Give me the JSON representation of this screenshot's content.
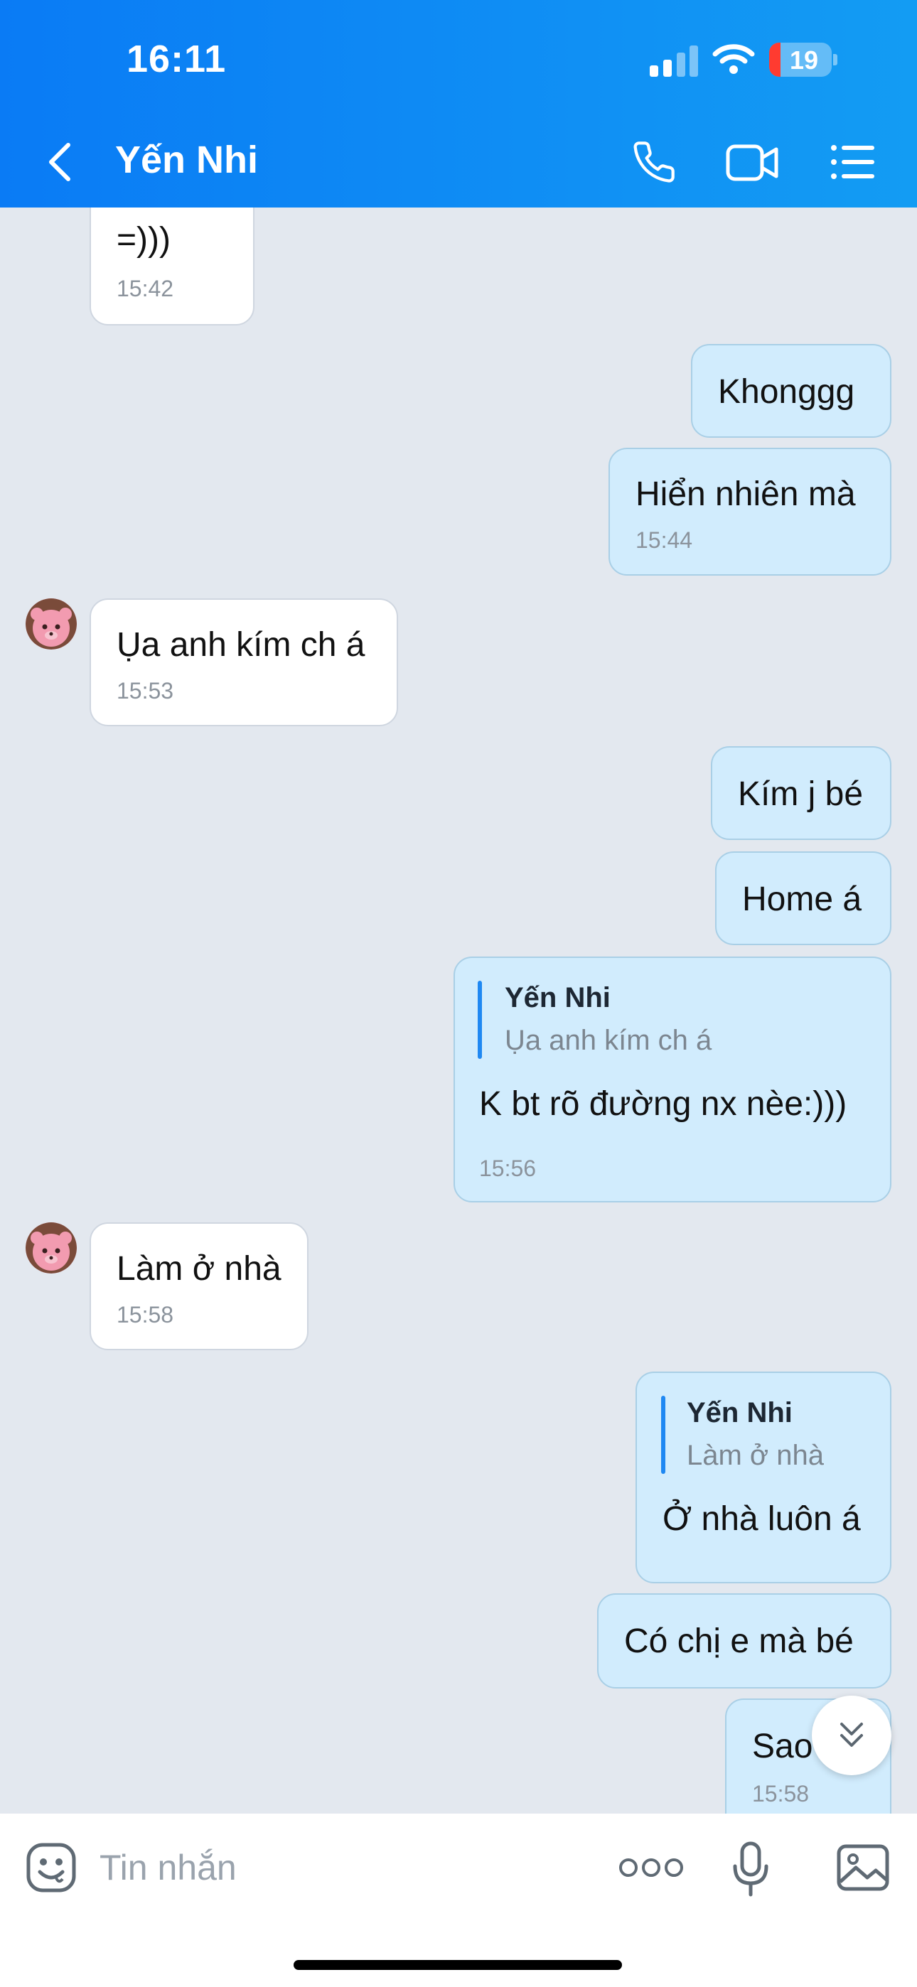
{
  "status_bar": {
    "time": "16:11",
    "battery": "19"
  },
  "header": {
    "title": "Yến Nhi"
  },
  "messages": {
    "m1": {
      "text": "=)))",
      "time": "15:42"
    },
    "m2": {
      "text": "Khonggg"
    },
    "m3": {
      "text": "Hiển nhiên mà",
      "time": "15:44"
    },
    "m4": {
      "text": "Ụa anh kím ch á",
      "time": "15:53"
    },
    "m5": {
      "text": "Kím j bé"
    },
    "m6": {
      "text": "Home á"
    },
    "m7": {
      "quote_name": "Yến Nhi",
      "quote_text": "Ụa anh kím ch á",
      "text": "K bt rõ đường nx nèe:)))",
      "time": "15:56"
    },
    "m8": {
      "text": "Làm ở nhà",
      "time": "15:58"
    },
    "m9": {
      "quote_name": "Yến Nhi",
      "quote_text": "Làm ở nhà",
      "text": "Ở nhà luôn á"
    },
    "m10": {
      "text": "Có chị e mà bé"
    },
    "m11": {
      "text": "Sao",
      "time": "15:58"
    }
  },
  "composer": {
    "placeholder": "Tin nhắn"
  },
  "colors": {
    "header_start": "#0a7bf5",
    "header_end": "#139cf3",
    "outgoing_bubble": "#d1ecfd",
    "incoming_bubble": "#ffffff",
    "chat_background": "#e3e8ef"
  },
  "icons": [
    "back-arrow-icon",
    "phone-icon",
    "video-camera-icon",
    "list-menu-icon",
    "emoji-icon",
    "more-icon",
    "microphone-icon",
    "image-icon",
    "scroll-down-icon"
  ]
}
